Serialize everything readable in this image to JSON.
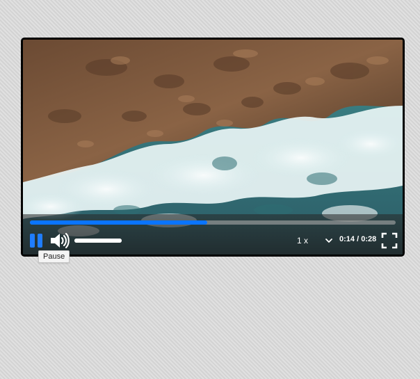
{
  "player": {
    "progress_fraction": 0.485,
    "volume_fraction": 1.0,
    "speed": "1 x",
    "time_current": "0:14",
    "time_separator": "/",
    "time_total": "0:28",
    "tooltip": "Pause"
  },
  "icons": {
    "pause": "pause-icon",
    "volume": "volume-high-icon",
    "speed_dropdown": "chevron-down-icon",
    "fullscreen": "fullscreen-icon"
  },
  "colors": {
    "accent": "#1f7dff",
    "progress_fill": "#0a74ff",
    "progress_track": "#aaaaaa",
    "control_text": "#ffffff"
  }
}
